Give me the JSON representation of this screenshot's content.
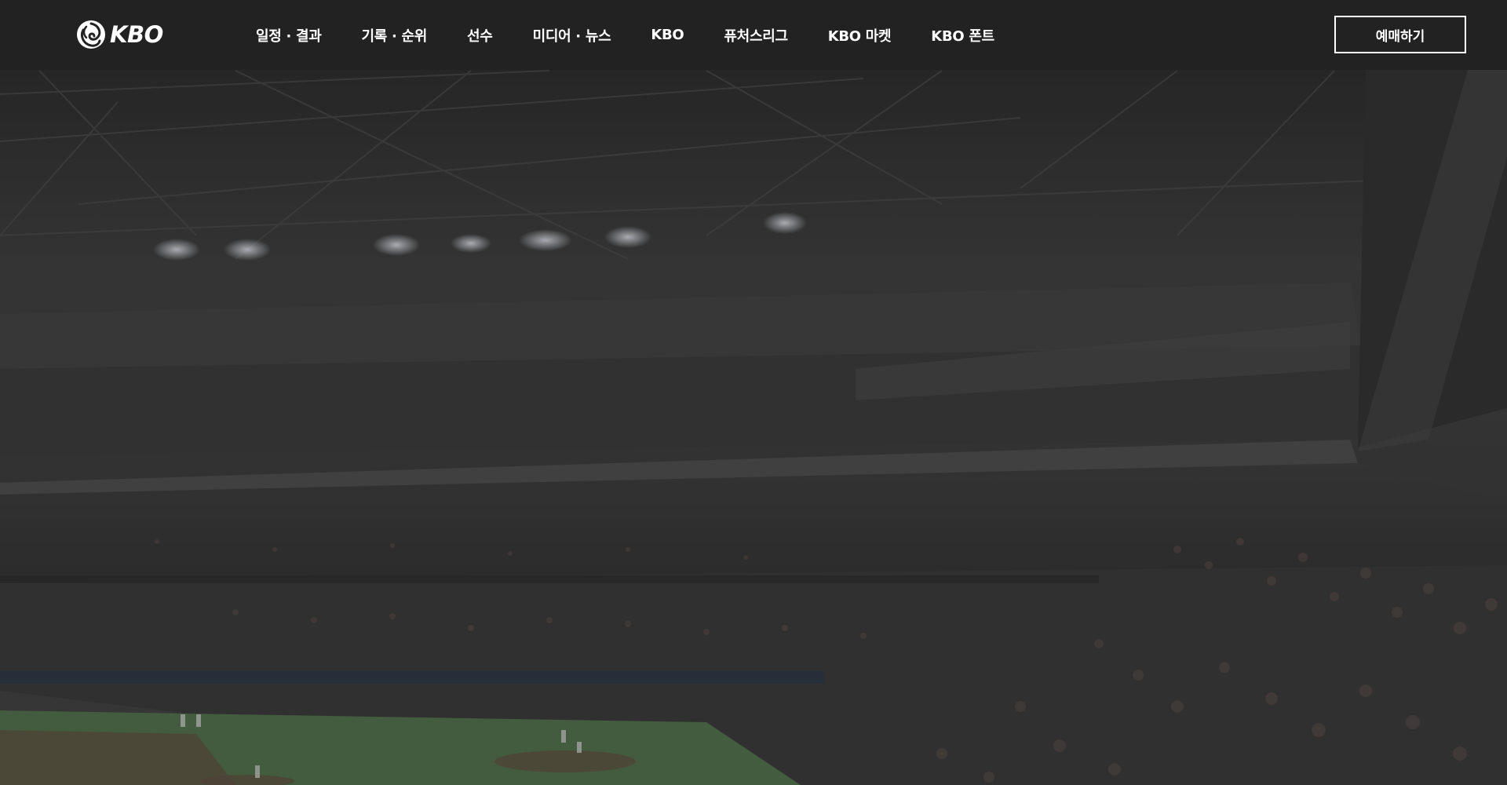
{
  "header": {
    "logo_text": "KBO",
    "nav": [
      {
        "label": "일정 · 결과"
      },
      {
        "label": "기록 · 순위"
      },
      {
        "label": "선수"
      },
      {
        "label": "미디어 · 뉴스"
      },
      {
        "label": "KBO"
      },
      {
        "label": "퓨처스리그"
      },
      {
        "label": "KBO 마켓"
      },
      {
        "label": "KBO 폰트"
      }
    ],
    "ticket_label": "예매하기"
  },
  "colors": {
    "header_bg": "#222222",
    "text": "#ffffff",
    "field_green": "#4d6b47"
  },
  "icons": {
    "logo": "kbo-swirl-logo-icon"
  }
}
